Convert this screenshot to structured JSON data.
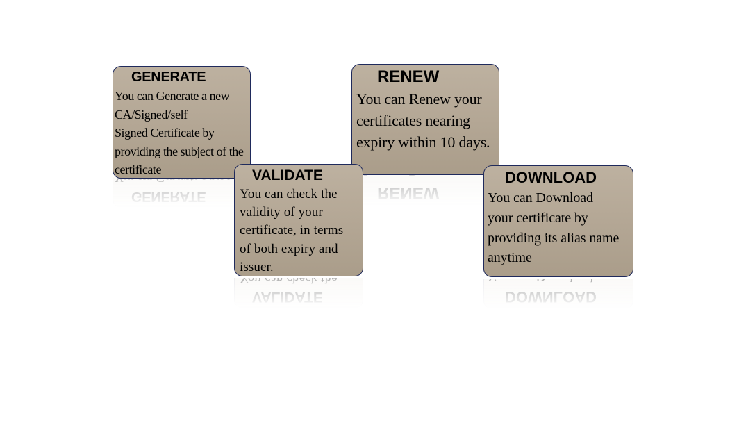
{
  "cards": {
    "generate": {
      "title": "GENERATE",
      "lines": [
        "You can Generate a new",
        "CA/Signed/self",
        "Signed Certificate by",
        "providing the subject of the",
        "certificate"
      ]
    },
    "renew": {
      "title": "RENEW",
      "lines": [
        "You can Renew your",
        "certificates nearing",
        "expiry within 10 days."
      ]
    },
    "validate": {
      "title": "VALIDATE",
      "lines": [
        "You can check the",
        "validity of your",
        "certificate, in terms",
        "of both expiry and",
        "issuer."
      ]
    },
    "download": {
      "title": "DOWNLOAD",
      "lines": [
        "You can Download",
        "your certificate by",
        "providing its alias name",
        "anytime"
      ]
    }
  },
  "colors": {
    "card_fill": "#b3a694",
    "card_border": "#1f2a5c",
    "text": "#000000",
    "background": "#ffffff"
  }
}
